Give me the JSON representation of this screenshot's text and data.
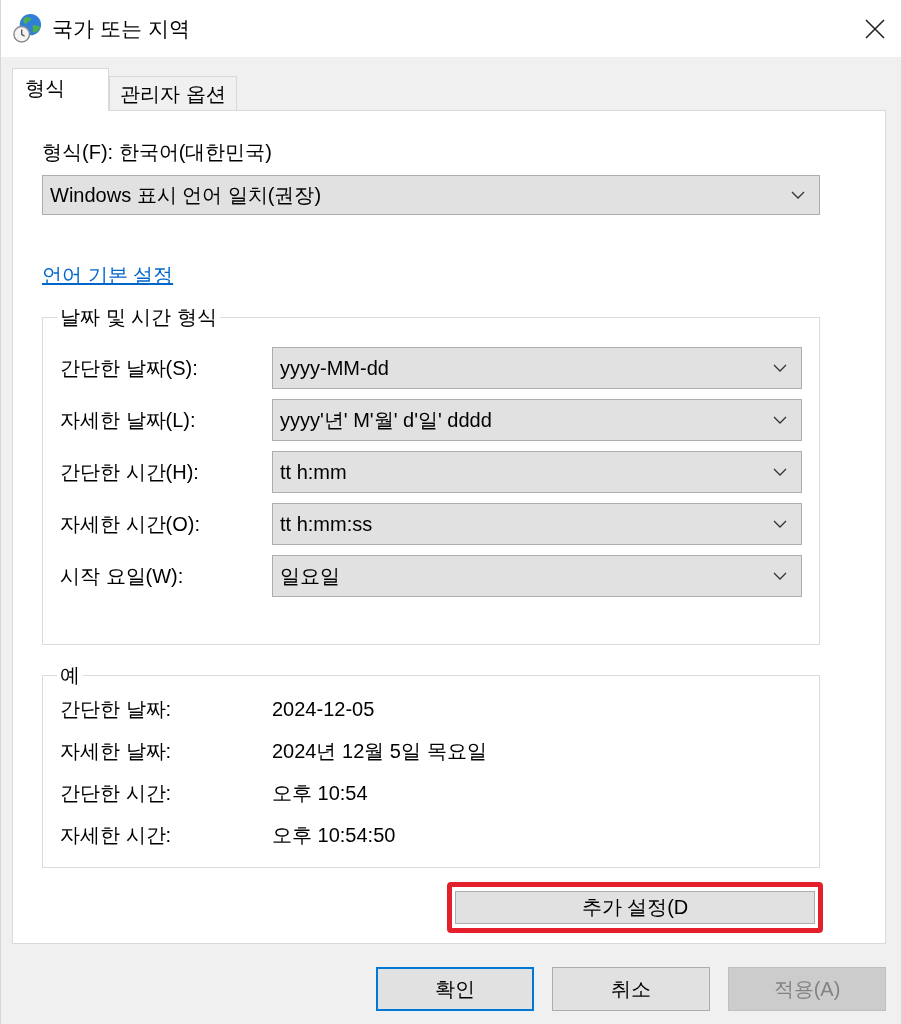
{
  "window": {
    "title": "국가 또는 지역"
  },
  "tabs": [
    {
      "label": "형식",
      "selected": true
    },
    {
      "label": "관리자 옵션",
      "selected": false
    }
  ],
  "format": {
    "label": "형식(F): 한국어(대한민국)",
    "dropdown": {
      "value": "Windows 표시 언어 일치(권장)"
    }
  },
  "language_settings_link": "언어 기본 설정",
  "date_time_formats": {
    "title": "날짜 및 시간 형식",
    "rows": [
      {
        "label": "간단한 날짜(S):",
        "value": "yyyy-MM-dd"
      },
      {
        "label": "자세한 날짜(L):",
        "value": "yyyy'년' M'월' d'일' dddd"
      },
      {
        "label": "간단한 시간(H):",
        "value": "tt h:mm"
      },
      {
        "label": "자세한 시간(O):",
        "value": "tt h:mm:ss"
      },
      {
        "label": "시작 요일(W):",
        "value": "일요일"
      }
    ]
  },
  "examples": {
    "title": "예",
    "rows": [
      {
        "label": "간단한 날짜:",
        "value": "2024-12-05"
      },
      {
        "label": "자세한 날짜:",
        "value": "2024년 12월 5일 목요일"
      },
      {
        "label": "간단한 시간:",
        "value": "오후 10:54"
      },
      {
        "label": "자세한 시간:",
        "value": "오후 10:54:50"
      }
    ]
  },
  "additional_settings_button": {
    "label": "추가 설정(D",
    "highlighted": true
  },
  "buttons": [
    {
      "label": "확인",
      "default": true,
      "disabled": false
    },
    {
      "label": "취소",
      "default": false,
      "disabled": false
    },
    {
      "label": "적용(A)",
      "default": false,
      "disabled": true
    }
  ]
}
